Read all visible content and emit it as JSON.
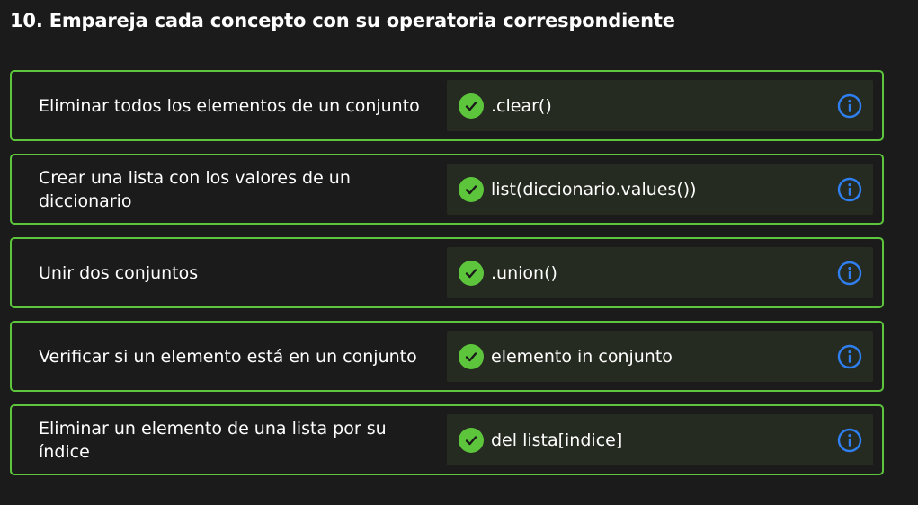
{
  "question": {
    "title": "10. Empareja cada concepto con su operatoria correspondiente"
  },
  "pairs": [
    {
      "concept": "Eliminar todos los elementos de un conjunto",
      "answer": ".clear()"
    },
    {
      "concept": "Crear una lista con los valores de un diccionario",
      "answer": "list(diccionario.values())"
    },
    {
      "concept": "Unir dos conjuntos",
      "answer": ".union()"
    },
    {
      "concept": "Verificar si un elemento está en un conjunto",
      "answer": "elemento in conjunto"
    },
    {
      "concept": "Eliminar un elemento de una lista por su índice",
      "answer": "del lista[indice]"
    }
  ],
  "icons": {
    "status": "check-circle-icon",
    "info": "info-icon"
  },
  "colors": {
    "background": "#1b1b1b",
    "correct_border": "#5cc53c",
    "check_fill": "#5cc53c",
    "answer_bg": "#252b20",
    "info_blue": "#2f7ff0"
  }
}
